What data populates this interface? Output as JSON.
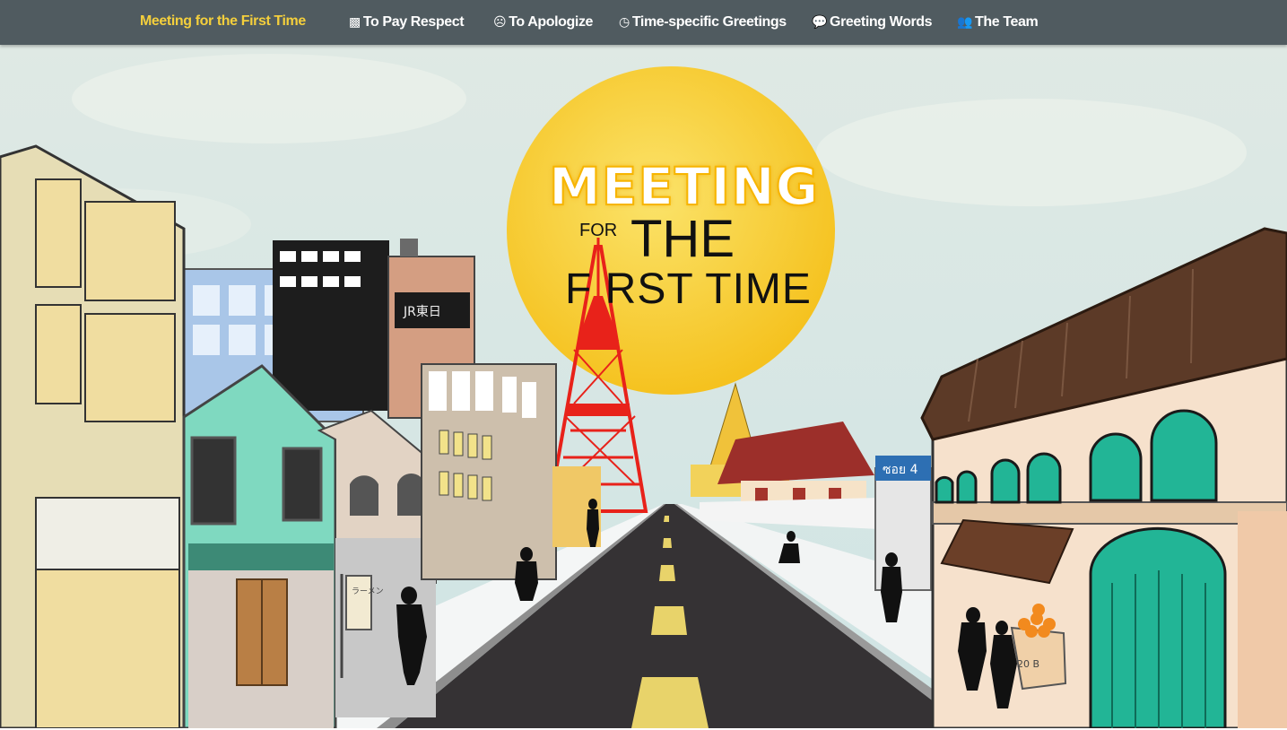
{
  "navbar": {
    "items": [
      {
        "label": "Meeting for the First Time",
        "icon": "",
        "icon_name": ""
      },
      {
        "label": "To Pay Respect",
        "icon": "▩",
        "icon_name": "praying-hands-icon"
      },
      {
        "label": "To Apologize",
        "icon": "☹",
        "icon_name": "frown-icon"
      },
      {
        "label": "Time-specific Greetings",
        "icon": "◷",
        "icon_name": "clock-icon"
      },
      {
        "label": "Greeting Words",
        "icon": "💬",
        "icon_name": "speech-bubble-icon"
      },
      {
        "label": "The Team",
        "icon": "👥",
        "icon_name": "users-icon"
      }
    ],
    "active_color": "#f4cf3c",
    "background": "#505b60"
  },
  "hero": {
    "title_line1": "MEETING",
    "title_for": "FOR",
    "title_the": "THE",
    "title_line3": "F RST TIME",
    "sign_text": "ซอย 4",
    "price_tag": "20 B",
    "ramen_sign": "ラーメン",
    "building_sign": "JR東日"
  },
  "colors": {
    "sky": "#d8e8e6",
    "sun": "#f7d63a",
    "tower": "#e8221a",
    "road": "#333333",
    "teal": "#22b596"
  }
}
